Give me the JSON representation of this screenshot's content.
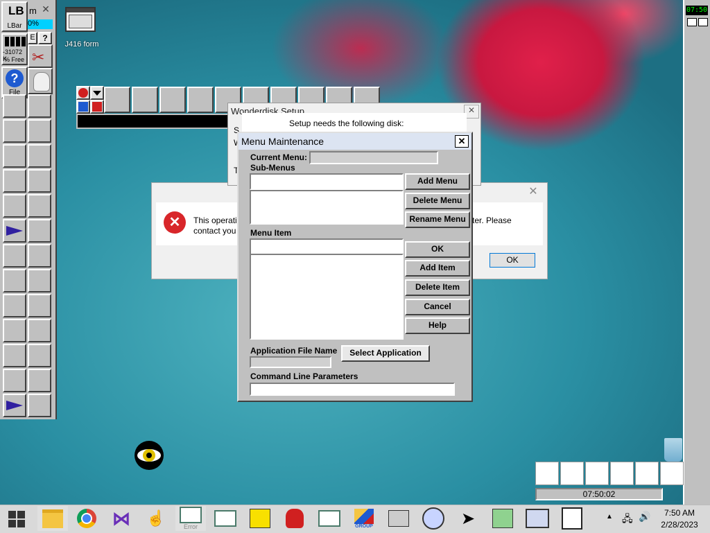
{
  "desktop": {
    "icon_label": "J416 form",
    "lbar": {
      "label": "LBar",
      "logo": "LB",
      "mem": "-31072 K",
      "mem_free": "% Free",
      "file_label": "File",
      "partial_m": "m",
      "partial_pct": "0%",
      "partial_e": "E",
      "partial_q": "?"
    }
  },
  "wonderdisk": {
    "title": "Wonderdisk Setup",
    "message": "Setup needs the following disk:",
    "frag_s": "S",
    "frag_w": "W",
    "frag_t": "T"
  },
  "error_dialog": {
    "text_left": "This operati",
    "text_left2": "contact you",
    "text_right": "ter. Please",
    "ok": "OK"
  },
  "menu_maintenance": {
    "title": "Menu Maintenance",
    "current_menu_label": "Current Menu:",
    "submenus_label": "Sub-Menus",
    "menu_item_label": "Menu Item",
    "app_file_label": "Application File Name",
    "cmd_params_label": "Command Line Parameters",
    "buttons": {
      "add_menu": "Add Menu",
      "delete_menu": "Delete Menu",
      "rename_menu": "Rename Menu",
      "ok": "OK",
      "add_item": "Add Item",
      "delete_item": "Delete Item",
      "cancel": "Cancel",
      "help": "Help",
      "select_app": "Select Application"
    }
  },
  "right_panel": {
    "clock_small": "07:50",
    "clock_big": "07:50:02"
  },
  "taskbar": {
    "time": "7:50 AM",
    "date": "2/28/2023",
    "error_label": "Error",
    "group_label": "GROUP"
  },
  "colors": {
    "accent": "#1a50c8",
    "title_active": "#dce4f2",
    "error_red": "#d8262a"
  }
}
